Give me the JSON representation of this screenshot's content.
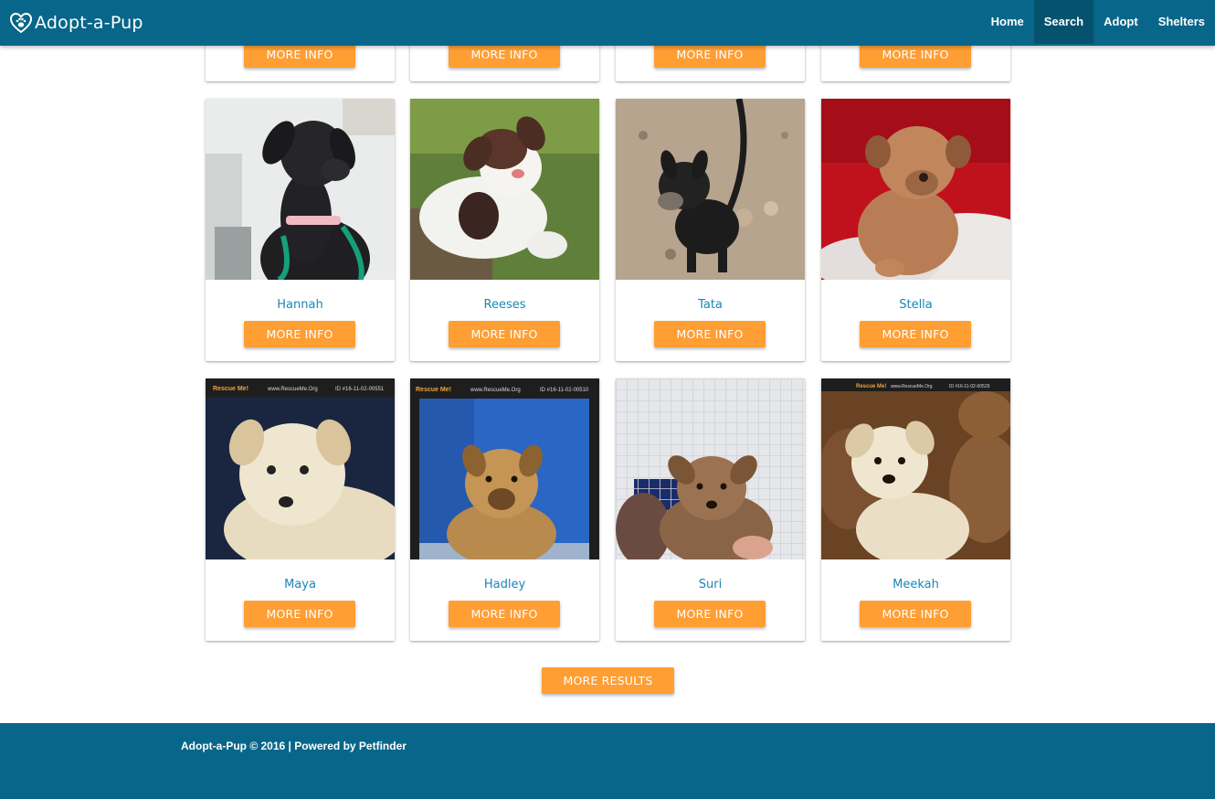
{
  "nav": {
    "brand": "Adopt-a-Pup",
    "links": [
      {
        "label": "Home",
        "active": false
      },
      {
        "label": "Search",
        "active": true
      },
      {
        "label": "Adopt",
        "active": false
      },
      {
        "label": "Shelters",
        "active": false
      }
    ]
  },
  "top_row": [
    {
      "button": "MORE INFO"
    },
    {
      "button": "MORE INFO"
    },
    {
      "button": "MORE INFO"
    },
    {
      "button": "MORE INFO"
    }
  ],
  "pups": [
    {
      "name": "Hannah",
      "button": "MORE INFO"
    },
    {
      "name": "Reeses",
      "button": "MORE INFO"
    },
    {
      "name": "Tata",
      "button": "MORE INFO"
    },
    {
      "name": "Stella",
      "button": "MORE INFO"
    },
    {
      "name": "Maya",
      "button": "MORE INFO",
      "photo_banner": {
        "left": "Rescue Me!",
        "mid": "www.RescueMe.Org",
        "right": "ID #16-11-02-00551"
      }
    },
    {
      "name": "Hadley",
      "button": "MORE INFO",
      "photo_banner": {
        "left": "Rescue Me!",
        "mid": "www.RescueMe.Org",
        "right": "ID #16-11-02-00510"
      }
    },
    {
      "name": "Suri",
      "button": "MORE INFO"
    },
    {
      "name": "Meekah",
      "button": "MORE INFO",
      "photo_banner": {
        "left": "Rescue Me!",
        "mid": "www.RescueMe.Org",
        "right": "ID #16-11-02-00529"
      }
    }
  ],
  "more_results": "MORE RESULTS",
  "footer": {
    "text": "Adopt-a-Pup © 2016 | Powered by Petfinder"
  },
  "colors": {
    "nav": "#076689",
    "accent": "#ff9e33",
    "name": "#1a86b6"
  }
}
